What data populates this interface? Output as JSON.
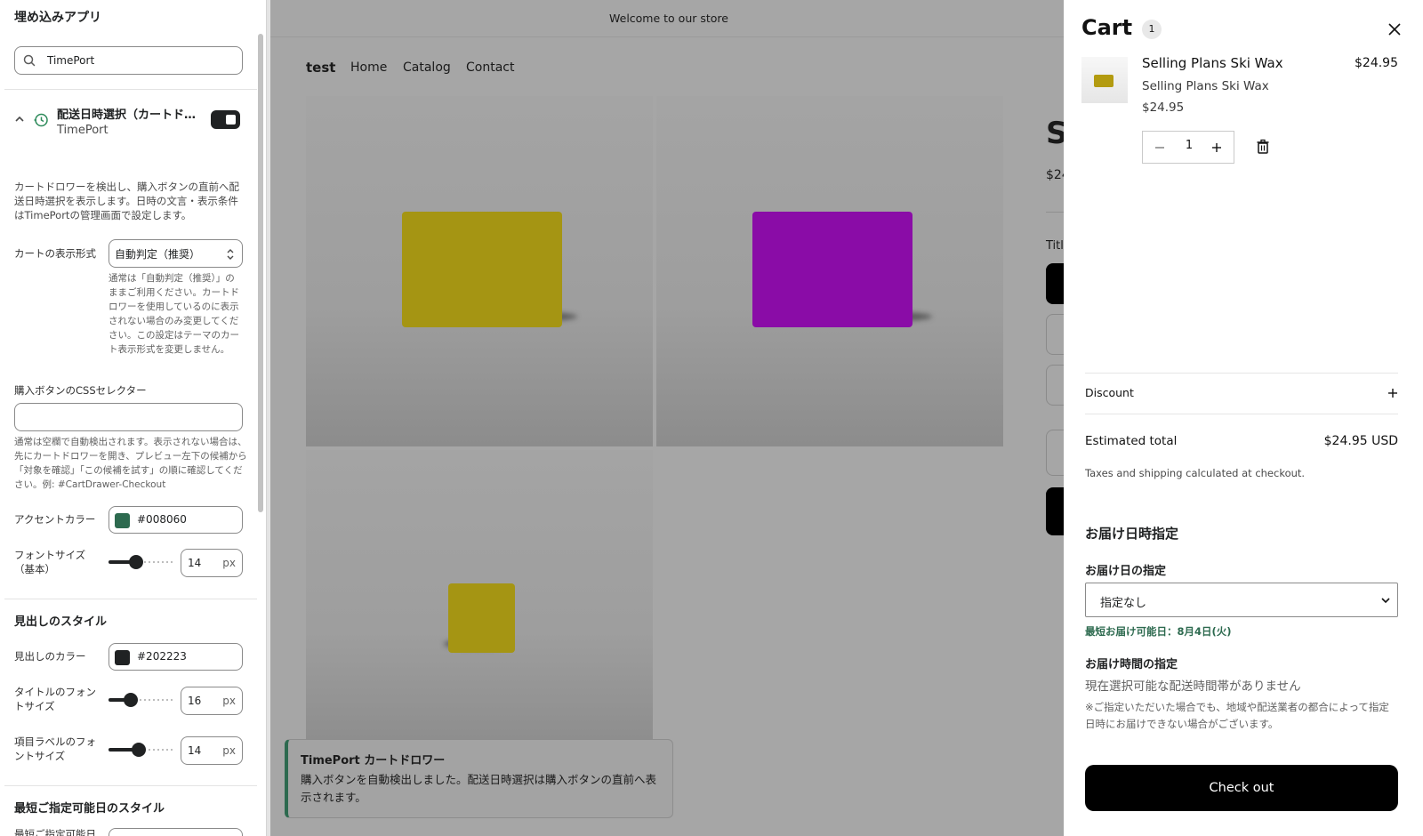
{
  "panel": {
    "title": "埋め込みアプリ",
    "search": {
      "value": "TimePort",
      "placeholder": ""
    },
    "block": {
      "title": "配送日時選択（カートドロワー）",
      "app": "TimePort",
      "enabled": true,
      "description": "カートドロワーを検出し、購入ボタンの直前へ配送日時選択を表示します。日時の文言・表示条件はTimePortの管理画面で設定します。"
    },
    "cart_type": {
      "label": "カートの表示形式",
      "value": "自動判定（推奨）",
      "help": "通常は「自動判定（推奨）」のままご利用ください。カートドロワーを使用しているのに表示されない場合のみ変更してください。この設定はテーマのカート表示形式を変更しません。"
    },
    "css_selector": {
      "label": "購入ボタンのCSSセレクター",
      "value": "",
      "help": "通常は空欄で自動検出されます。表示されない場合は、先にカートドロワーを開き、プレビュー左下の候補から「対象を確認」「この候補を試す」の順に確認してください。例: #CartDrawer-Checkout"
    },
    "accent": {
      "label": "アクセントカラー",
      "value": "#008060",
      "swatch": "#2d6a4f"
    },
    "font_size": {
      "label": "フォントサイズ（基本）",
      "value": "14",
      "unit": "px",
      "level": 0.4
    },
    "heading_section": "見出しのスタイル",
    "heading_color": {
      "label": "見出しのカラー",
      "value": "#202223",
      "swatch": "#202223"
    },
    "title_size": {
      "label": "タイトルのフォントサイズ",
      "value": "16",
      "unit": "px",
      "level": 0.3
    },
    "label_size": {
      "label": "項目ラベルのフォントサイズ",
      "value": "14",
      "unit": "px",
      "level": 0.45
    },
    "earliest_section": "最短ご指定可能日のスタイル",
    "earliest_partial": "最短ご指定可能日"
  },
  "store": {
    "announcement": "Welcome to our store",
    "brand": "test",
    "nav": [
      "Home",
      "Catalog",
      "Contact"
    ],
    "peek_title": "S",
    "peek_price": "$24",
    "peek_label": "Titl",
    "product_colors": {
      "yellow": "#a59513",
      "purple": "#8a0ca7"
    },
    "toast": {
      "title": "TimePort カートドロワー",
      "body": "購入ボタンを自動検出しました。配送日時選択は購入ボタンの直前へ表示されます。"
    }
  },
  "cart": {
    "title": "Cart",
    "count": "1",
    "item": {
      "name": "Selling Plans Ski Wax",
      "price": "$24.95",
      "variant": "Selling Plans Ski Wax",
      "unit_price": "$24.95",
      "quantity": "1"
    },
    "discount_label": "Discount",
    "estimated_label": "Estimated total",
    "estimated_value": "$24.95 USD",
    "tax_note": "Taxes and shipping calculated at checkout.",
    "delivery": {
      "heading": "お届け日時指定",
      "date_label": "お届け日の指定",
      "date_value": "指定なし",
      "earliest": "最短お届け可能日：8月4日(火)",
      "time_label": "お届け時間の指定",
      "time_none": "現在選択可能な配送時間帯がありません",
      "note": "※ご指定いただいた場合でも、地域や配送業者の都合によって指定日時にお届けできない場合がございます。"
    },
    "checkout": "Check out"
  }
}
